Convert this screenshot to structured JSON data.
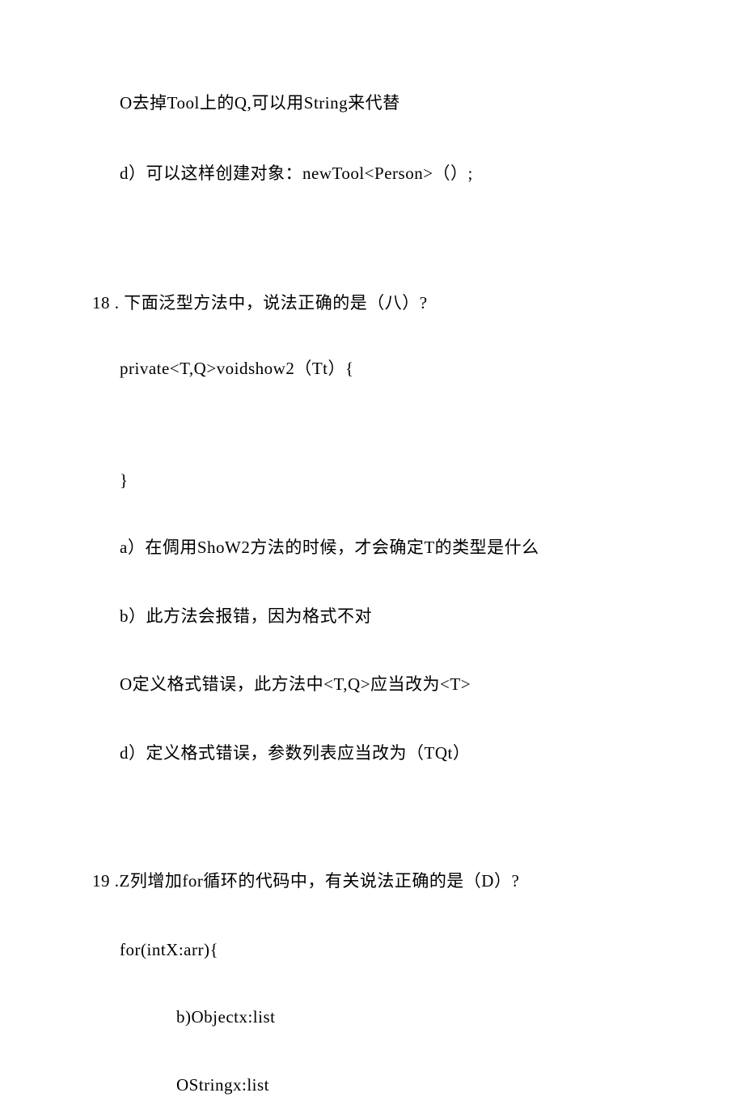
{
  "q17": {
    "opt_c": "O去掉Tool上的Q,可以用String来代替",
    "opt_d": "d）可以这样创建对象：newTool<Person>（）;"
  },
  "q18": {
    "stem": "18 . 下面泛型方法中，说法正确的是（八）?",
    "code1": "private<T,Q>voidshow2（Tt）{",
    "code2": "}",
    "opt_a": "a）在倜用ShoW2方法的时候，才会确定T的类型是什么",
    "opt_b": "b）此方法会报错，因为格式不对",
    "opt_c": "O定义格式错误，此方法中<T,Q>应当改为<T>",
    "opt_d": "d）定义格式错误，参数列表应当改为（TQt）"
  },
  "q19": {
    "stem": "19 .Z列增加for循环的代码中，有关说法正确的是（D）?",
    "code1": "for(intX:arr){",
    "opt_b": "b)Objectx:list",
    "opt_c": "OStringx:list"
  }
}
